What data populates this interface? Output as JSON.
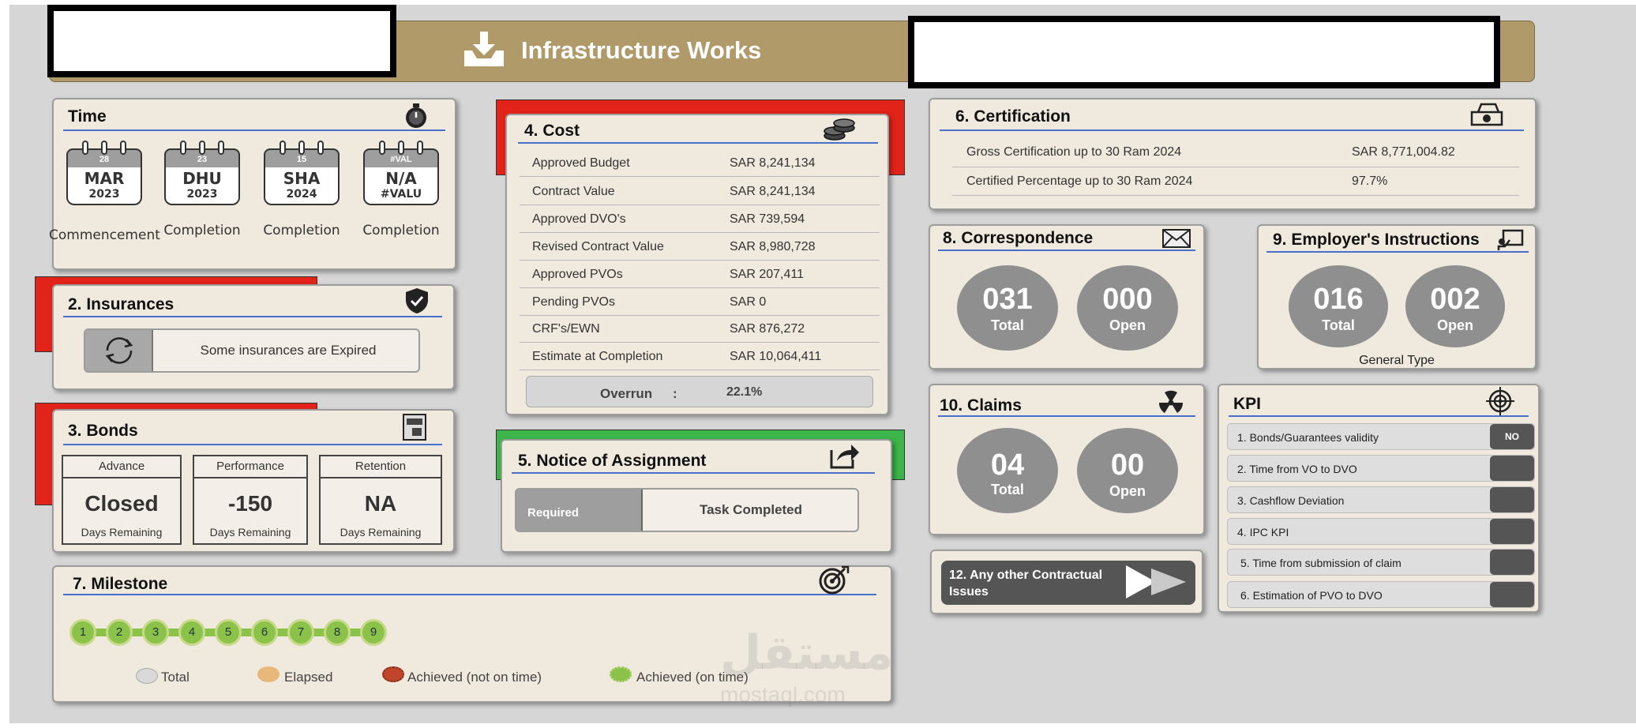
{
  "header": {
    "title": "Infrastructure Works",
    "icon": "inbox-download-icon"
  },
  "time": {
    "title": "Time",
    "calendars": [
      {
        "day": "28",
        "month": "MAR",
        "year": "2023",
        "caption": "Commencement"
      },
      {
        "day": "23",
        "month": "DHU",
        "year": "2023",
        "caption": "Completion"
      },
      {
        "day": "15",
        "month": "SHA",
        "year": "2024",
        "caption": "Completion"
      },
      {
        "day": "#VAL",
        "month": "N/A",
        "year": "#VALU",
        "caption": "Completion"
      }
    ]
  },
  "insurances": {
    "title": "2. Insurances",
    "status": "Some insurances are Expired"
  },
  "bonds": {
    "title": "3. Bonds",
    "items": [
      {
        "header": "Advance",
        "value": "Closed",
        "sub": "Days Remaining"
      },
      {
        "header": "Performance",
        "value": "-150",
        "sub": "Days Remaining"
      },
      {
        "header": "Retention",
        "value": "NA",
        "sub": "Days Remaining"
      }
    ]
  },
  "cost": {
    "title": "4. Cost",
    "rows": [
      {
        "label": "Approved Budget",
        "value": "SAR 8,241,134"
      },
      {
        "label": "Contract Value",
        "value": "SAR 8,241,134"
      },
      {
        "label": "Approved DVO's",
        "value": "SAR 739,594"
      },
      {
        "label": "Revised Contract Value",
        "value": "SAR 8,980,728"
      },
      {
        "label": "Approved PVOs",
        "value": "SAR 207,411"
      },
      {
        "label": "Pending PVOs",
        "value": "SAR 0"
      },
      {
        "label": "CRF's/EWN",
        "value": "SAR 876,272"
      },
      {
        "label": "Estimate at Completion",
        "value": "SAR 10,064,411"
      }
    ],
    "overrun_label": "Overrun",
    "overrun_sep": ":",
    "overrun_value": "22.1%"
  },
  "notice": {
    "title": "5. Notice of Assignment",
    "left": "Required",
    "right": "Task Completed"
  },
  "certification": {
    "title": "6. Certification",
    "rows": [
      {
        "label": "Gross Certification up to 30 Ram 2024",
        "value": "SAR 8,771,004.82"
      },
      {
        "label": "Certified Percentage up to 30 Ram 2024",
        "value": "97.7%"
      }
    ]
  },
  "milestone": {
    "title": "7. Milestone",
    "dots": [
      "1",
      "2",
      "3",
      "4",
      "5",
      "6",
      "7",
      "8",
      "9"
    ],
    "legend": [
      {
        "label": "Total",
        "color": "#d9d9d9"
      },
      {
        "label": "Elapsed",
        "color": "#e8b77a"
      },
      {
        "label": "Achieved (not on time)",
        "color": "#c0452a"
      },
      {
        "label": "Achieved (on time)",
        "color": "#8bc34a"
      }
    ]
  },
  "correspondence": {
    "title": "8. Correspondence",
    "total": "031",
    "total_label": "Total",
    "open": "000",
    "open_label": "Open"
  },
  "employer": {
    "title": "9. Employer's Instructions",
    "total": "016",
    "total_label": "Total",
    "open": "002",
    "open_label": "Open",
    "footer": "General Type"
  },
  "claims": {
    "title": "10. Claims",
    "total": "04",
    "total_label": "Total",
    "open": "00",
    "open_label": "Open"
  },
  "issues": {
    "label": "12. Any other Contractual Issues"
  },
  "kpi": {
    "title": "KPI",
    "rows": [
      {
        "label": "1. Bonds/Guarantees validity",
        "badge": "NO"
      },
      {
        "label": "2. Time from VO to DVO",
        "badge": ""
      },
      {
        "label": "3. Cashflow Deviation",
        "badge": ""
      },
      {
        "label": "4. IPC KPI",
        "badge": ""
      },
      {
        "label": "5. Time from submission of claim",
        "badge": ""
      },
      {
        "label": "6. Estimation of PVO to DVO",
        "badge": ""
      }
    ]
  },
  "watermark": {
    "arabic": "مستقل",
    "latin": "mostaql.com"
  },
  "colors": {
    "header": "#b09a6a",
    "panel": "#efe9de",
    "alert_red": "#e2231a",
    "ok_green": "#3cb54a",
    "rule_blue": "#4a6fc9"
  }
}
